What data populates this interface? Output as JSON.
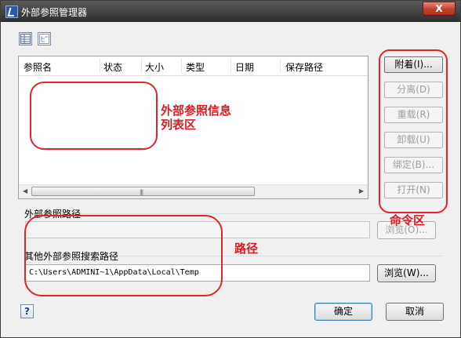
{
  "window": {
    "title": "外部参照管理器",
    "close_label": "X"
  },
  "toolbar": {
    "list_view": "list-view-icon",
    "tree_view": "tree-view-icon"
  },
  "list": {
    "columns": [
      "参照名",
      "状态",
      "大小",
      "类型",
      "日期",
      "保存路径"
    ],
    "scroll_grip": "|||"
  },
  "commands": [
    {
      "label": "附着(I)...",
      "enabled": true
    },
    {
      "label": "分离(D)",
      "enabled": false
    },
    {
      "label": "重载(R)",
      "enabled": false
    },
    {
      "label": "卸载(U)",
      "enabled": false
    },
    {
      "label": "绑定(B)...",
      "enabled": false
    },
    {
      "label": "打开(N)",
      "enabled": false
    }
  ],
  "xref_path": {
    "label": "外部参照路径",
    "value": "",
    "browse_label": "浏览(O)..."
  },
  "search_path": {
    "label": "其他外部参照搜索路径",
    "value": "C:\\Users\\ADMINI~1\\AppData\\Local\\Temp",
    "browse_label": "浏览(W)..."
  },
  "footer": {
    "help_label": "?",
    "ok_label": "确定",
    "cancel_label": "取消"
  },
  "annotations": {
    "list_area": [
      "外部参照信息",
      "列表区"
    ],
    "command_area": "命令区",
    "path_area": "路径",
    "color": "#e0242a"
  }
}
